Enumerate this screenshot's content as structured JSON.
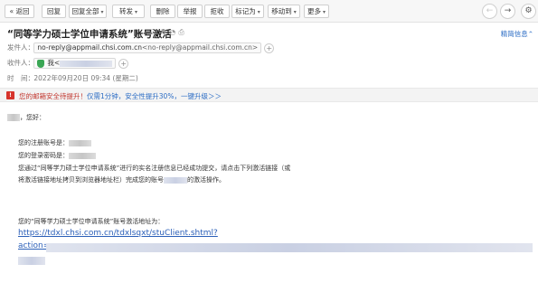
{
  "toolbar": {
    "back": "返回",
    "reply": "回复",
    "reply_all": "回复全部",
    "forward": "转发",
    "delete": "删除",
    "report": "举报",
    "reject": "拒收",
    "mark_as": "标记为",
    "move_to": "移动到",
    "more": "更多",
    "back_icon": "double-chevron-left-icon",
    "prev_icon": "arrow-left-icon",
    "next_icon": "arrow-right-icon",
    "settings_icon": "gear-icon"
  },
  "email": {
    "subject": "“同等学力硕士学位申请系统”账号激活",
    "detail_link": "精简信息",
    "from_label": "发件人：",
    "from_email": "no-reply@appmail.chsi.com.cn",
    "from_address": "<no-reply@appmail.chsi.com.cn>",
    "to_label": "收件人：",
    "to_name": "我<",
    "time_label": "时　间：",
    "time_value": "2022年09月20日 09:34 (星期二)"
  },
  "banner": {
    "icon_text": "!",
    "warning": "您的邮箱安全待提升！",
    "cta": "仅需1分钟，安全性提升30%，一键升级＞＞"
  },
  "body": {
    "greeting": "，您好：",
    "username_label": "您的注册账号是：",
    "password_label": "您的登录密码是：",
    "line1": "您通过“同等学力硕士学位申请系统”进行的实名注册信息已经成功提交，请点击下列激活链接（或",
    "line2_a": "将激活链接地址拷贝到浏览器地址栏）完成您的账号",
    "line2_b": "的激活操作。",
    "activation_label": "您的“同等学力硕士学位申请系统”账号激活地址为：",
    "link_line1": "https://tdxl.chsi.com.cn/tdxlsqxt/stuClient.shtml?",
    "link_line2": "action="
  }
}
